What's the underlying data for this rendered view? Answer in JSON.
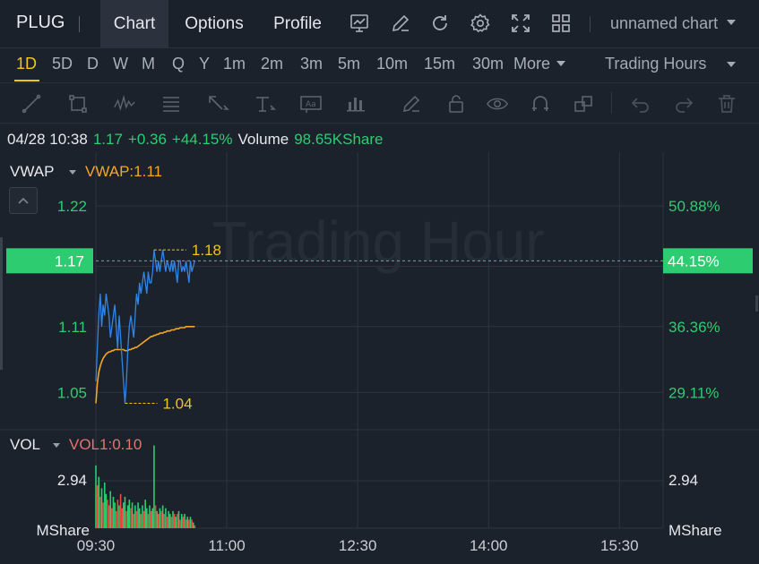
{
  "header": {
    "ticker": "PLUG",
    "tabs": [
      "Chart",
      "Options",
      "Profile"
    ],
    "active_tab": 0,
    "icons": [
      "chart-type-icon",
      "pen-icon",
      "refresh-icon",
      "settings-icon",
      "fullscreen-icon",
      "layout-grid-icon"
    ],
    "chart_name": "unnamed chart"
  },
  "timeframes": {
    "items": [
      "1D",
      "5D",
      "D",
      "W",
      "M",
      "Q",
      "Y",
      "1m",
      "2m",
      "3m",
      "5m",
      "10m",
      "15m",
      "30m",
      "More"
    ],
    "active": "1D",
    "session": "Trading Hours"
  },
  "toolbar": {
    "tools": [
      "trendline-icon",
      "rectangle-icon",
      "wave-icon",
      "fibonacci-icon",
      "arrow-icon",
      "text-icon",
      "annotation-icon",
      "measure-icon",
      "brush-icon",
      "lock-icon",
      "eye-icon",
      "magnet-icon",
      "clone-icon",
      "undo-icon",
      "redo-icon",
      "trash-icon"
    ]
  },
  "quote": {
    "datetime": "04/28 10:38",
    "price": "1.17",
    "change": "+0.36",
    "change_pct": "+44.15%",
    "volume_label": "Volume",
    "volume": "98.65KShare"
  },
  "indicators": {
    "main": "VWAP",
    "main_value": "VWAP:1.11",
    "sub": "VOL",
    "sub_value": "VOL1:0.10"
  },
  "watermark": "Trading Hour",
  "colors": {
    "price_line": "#2f86e8",
    "vwap_line": "#f5a623",
    "green": "#2ecc71",
    "red": "#e74c3c",
    "grid": "#2c3440",
    "high_low_label": "#f0c419"
  },
  "chart_data": {
    "type": "line",
    "title": "",
    "xlabel": "",
    "ylabel": "",
    "x_ticks": [
      "09:30",
      "11:00",
      "12:30",
      "14:00",
      "15:30"
    ],
    "y_ticks": [
      "1.22",
      "1.11",
      "1.05"
    ],
    "y_ticks_right": [
      "50.88%",
      "36.36%",
      "29.11%"
    ],
    "ylim": [
      1.02,
      1.265
    ],
    "current_price": "1.17",
    "current_pct": "44.15%",
    "high_label": "1.18",
    "low_label": "1.04",
    "x_minutes": [
      0,
      1,
      2,
      3,
      4,
      5,
      6,
      7,
      8,
      9,
      10,
      11,
      12,
      13,
      14,
      15,
      16,
      17,
      18,
      19,
      20,
      21,
      22,
      23,
      24,
      25,
      26,
      27,
      28,
      29,
      30,
      31,
      32,
      33,
      34,
      35,
      36,
      37,
      38,
      39,
      40,
      41,
      42,
      43,
      44,
      45,
      46,
      47,
      48,
      49,
      50,
      51,
      52,
      53,
      54,
      55,
      56,
      57,
      58,
      59,
      60,
      61,
      62,
      63,
      64,
      65,
      66,
      67,
      68
    ],
    "series": [
      {
        "name": "",
        "values": [
          1.06,
          1.09,
          1.12,
          1.14,
          1.11,
          1.13,
          1.12,
          1.14,
          1.13,
          1.12,
          1.1,
          1.11,
          1.12,
          1.13,
          1.11,
          1.09,
          1.12,
          1.1,
          1.08,
          1.06,
          1.04,
          1.06,
          1.09,
          1.11,
          1.12,
          1.11,
          1.1,
          1.12,
          1.14,
          1.13,
          1.15,
          1.14,
          1.15,
          1.16,
          1.15,
          1.14,
          1.16,
          1.15,
          1.15,
          1.16,
          1.18,
          1.17,
          1.16,
          1.17,
          1.16,
          1.17,
          1.18,
          1.17,
          1.16,
          1.17,
          1.165,
          1.16,
          1.17,
          1.16,
          1.17,
          1.16,
          1.15,
          1.17,
          1.17,
          1.16,
          1.165,
          1.16,
          1.17,
          1.16,
          1.15,
          1.17,
          1.16,
          1.165,
          1.17
        ]
      },
      {
        "name": "VWAP",
        "values": [
          1.04,
          1.058,
          1.068,
          1.074,
          1.078,
          1.081,
          1.083,
          1.085,
          1.086,
          1.087,
          1.087,
          1.088,
          1.088,
          1.089,
          1.089,
          1.089,
          1.089,
          1.089,
          1.089,
          1.089,
          1.088,
          1.088,
          1.088,
          1.089,
          1.089,
          1.09,
          1.09,
          1.091,
          1.091,
          1.092,
          1.093,
          1.094,
          1.095,
          1.096,
          1.097,
          1.098,
          1.099,
          1.1,
          1.101,
          1.101,
          1.102,
          1.102,
          1.103,
          1.103,
          1.104,
          1.104,
          1.104,
          1.105,
          1.105,
          1.106,
          1.106,
          1.106,
          1.107,
          1.107,
          1.107,
          1.108,
          1.108,
          1.108,
          1.109,
          1.109,
          1.109,
          1.109,
          1.11,
          1.11,
          1.11,
          1.11,
          1.11,
          1.11,
          1.11
        ]
      }
    ],
    "volume": {
      "ylim": [
        0,
        3.2
      ],
      "y_label": "2.94",
      "unit": "MShare",
      "values": [
        2.2,
        1.5,
        1.8,
        1.1,
        1.4,
        0.9,
        1.6,
        1.2,
        1.0,
        0.8,
        1.3,
        0.7,
        1.1,
        0.9,
        0.6,
        1.0,
        0.8,
        1.2,
        0.7,
        0.9,
        1.1,
        0.6,
        0.8,
        1.0,
        0.7,
        0.9,
        0.5,
        0.8,
        0.6,
        0.9,
        0.7,
        0.5,
        0.8,
        0.6,
        1.0,
        0.7,
        0.5,
        0.8,
        0.6,
        0.7,
        2.9,
        0.8,
        0.6,
        0.5,
        0.7,
        0.6,
        0.8,
        0.5,
        0.7,
        0.4,
        0.6,
        0.5,
        0.4,
        0.6,
        0.5,
        0.4,
        0.5,
        0.6,
        0.3,
        0.5,
        0.4,
        0.5,
        0.3,
        0.4,
        0.3,
        0.4,
        0.3,
        0.2,
        0.1
      ],
      "up": [
        1,
        0,
        1,
        0,
        1,
        0,
        1,
        1,
        0,
        0,
        1,
        0,
        1,
        1,
        0,
        0,
        1,
        0,
        0,
        1,
        1,
        0,
        1,
        1,
        0,
        1,
        0,
        1,
        0,
        1,
        1,
        0,
        1,
        0,
        1,
        1,
        0,
        1,
        0,
        1,
        1,
        0,
        1,
        0,
        1,
        0,
        1,
        0,
        1,
        0,
        1,
        1,
        0,
        1,
        0,
        1,
        0,
        1,
        0,
        1,
        0,
        1,
        0,
        1,
        0,
        1,
        0,
        1,
        0
      ]
    }
  }
}
